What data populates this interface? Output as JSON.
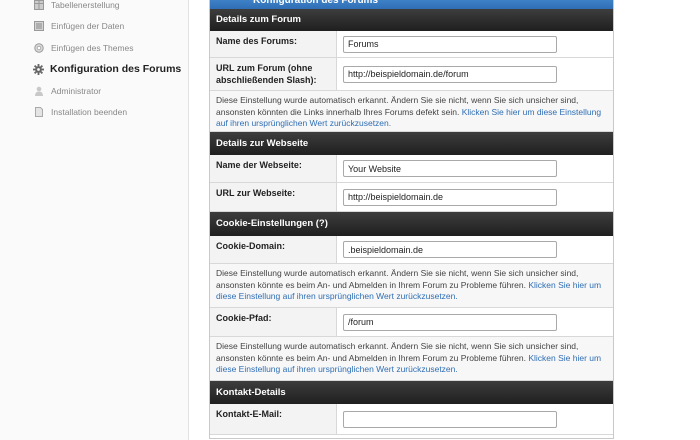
{
  "sidebar": {
    "items": [
      {
        "label": "Tabellenerstellung",
        "icon": "table-icon",
        "active": false
      },
      {
        "label": "Einfügen der Daten",
        "icon": "database-icon",
        "active": false
      },
      {
        "label": "Einfügen des Themes",
        "icon": "circle-icon",
        "active": false
      },
      {
        "label": "Konfiguration des Forums",
        "icon": "gear-icon",
        "active": true
      },
      {
        "label": "Administrator",
        "icon": "user-icon",
        "active": false
      },
      {
        "label": "Installation beenden",
        "icon": "document-icon",
        "active": false
      }
    ]
  },
  "panel": {
    "title": "Konfiguration des Forums",
    "sections": {
      "forum": {
        "heading": "Details zum Forum",
        "name_label": "Name des Forums:",
        "name_value": "Forums",
        "url_label": "URL zum Forum (ohne abschließenden Slash):",
        "url_value": "http://beispieldomain.de/forum",
        "note_text": "Diese Einstellung wurde automatisch erkannt. Ändern Sie sie nicht, wenn Sie sich unsicher sind, ansonsten könnten die Links innerhalb Ihres Forums defekt sein.",
        "note_link": "Klicken Sie hier um diese Einstellung auf ihren ursprünglichen Wert zurückzusetzen."
      },
      "website": {
        "heading": "Details zur Webseite",
        "name_label": "Name der Webseite:",
        "name_value": "Your Website",
        "url_label": "URL zur Webseite:",
        "url_value": "http://beispieldomain.de"
      },
      "cookie": {
        "heading": "Cookie-Einstellungen (?)",
        "domain_label": "Cookie-Domain:",
        "domain_value": ".beispieldomain.de",
        "domain_note_text": "Diese Einstellung wurde automatisch erkannt. Ändern Sie sie nicht, wenn Sie sich unsicher sind, ansonsten könnte es beim An- und Abmelden in Ihrem Forum zu Probleme führen.",
        "domain_note_link": "Klicken Sie hier um diese Einstellung auf ihren ursprünglichen Wert zurückzusetzen.",
        "path_label": "Cookie-Pfad:",
        "path_value": "/forum",
        "path_note_text": "Diese Einstellung wurde automatisch erkannt. Ändern Sie sie nicht, wenn Sie sich unsicher sind, ansonsten könnte es beim An- und Abmelden in Ihrem Forum zu Probleme führen.",
        "path_note_link": "Klicken Sie hier um diese Einstellung auf ihren ursprünglichen Wert zurückzusetzen."
      },
      "contact": {
        "heading": "Kontakt-Details",
        "email_label": "Kontakt-E-Mail:",
        "email_value": ""
      }
    }
  },
  "colors": {
    "section_bg": "#2a2a2a",
    "title_bg": "#3b7cc4",
    "link": "#2f6eb5"
  }
}
